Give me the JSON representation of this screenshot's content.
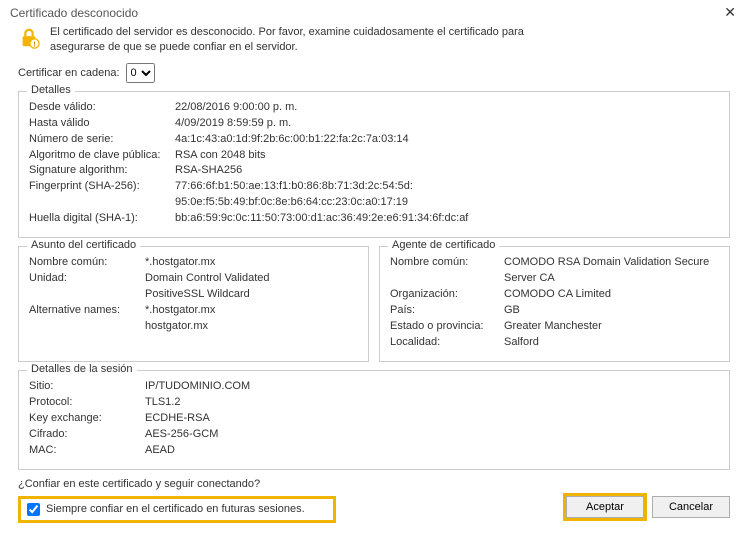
{
  "title": "Certificado desconocido",
  "warning": "El certificado del servidor es desconocido. Por favor, examine cuidadosamente el certificado para asegurarse de que se puede confiar en el servidor.",
  "chain_label": "Certificar en cadena:",
  "chain_value": "0",
  "details": {
    "title": "Detalles",
    "rows": {
      "valid_from_k": "Desde válido:",
      "valid_from_v": "22/08/2016 9:00:00 p. m.",
      "valid_to_k": "Hasta válido",
      "valid_to_v": "4/09/2019 8:59:59 p. m.",
      "serial_k": "Número de serie:",
      "serial_v": "4a:1c:43:a0:1d:9f:2b:6c:00:b1:22:fa:2c:7a:03:14",
      "pubkey_k": "Algoritmo de clave pública:",
      "pubkey_v": "RSA con 2048 bits",
      "sigalg_k": "Signature algorithm:",
      "sigalg_v": "RSA-SHA256",
      "fp256_k": "Fingerprint (SHA-256):",
      "fp256_v1": "77:66:6f:b1:50:ae:13:f1:b0:86:8b:71:3d:2c:54:5d:",
      "fp256_v2": "95:0e:f5:5b:49:bf:0c:8e:b6:64:cc:23:0c:a0:17:19",
      "fp1_k": "Huella digital (SHA-1):",
      "fp1_v": "bb:a6:59:9c:0c:11:50:73:00:d1:ac:36:49:2e:e6:91:34:6f:dc:af"
    }
  },
  "subject": {
    "title": "Asunto del certificado",
    "cn_k": "Nombre común:",
    "cn_v": "*.hostgator.mx",
    "unit_k": "Unidad:",
    "unit_v1": "Domain Control Validated",
    "unit_v2": "PositiveSSL Wildcard",
    "alt_k": "Alternative names:",
    "alt_v1": "*.hostgator.mx",
    "alt_v2": "hostgator.mx"
  },
  "issuer": {
    "title": "Agente de certificado",
    "cn_k": "Nombre común:",
    "cn_v": "COMODO RSA Domain Validation Secure Server CA",
    "org_k": "Organización:",
    "org_v": "COMODO CA Limited",
    "country_k": "País:",
    "country_v": "GB",
    "state_k": "Estado o provincia:",
    "state_v": "Greater Manchester",
    "locality_k": "Localidad:",
    "locality_v": "Salford"
  },
  "session": {
    "title": "Detalles de la sesión",
    "site_k": "Sitio:",
    "site_v": "IP/TUDOMINIO.COM",
    "proto_k": "Protocol:",
    "proto_v": "TLS1.2",
    "kex_k": "Key exchange:",
    "kex_v": "ECDHE-RSA",
    "cipher_k": "Cifrado:",
    "cipher_v": "AES-256-GCM",
    "mac_k": "MAC:",
    "mac_v": "AEAD"
  },
  "trust_question": "¿Confiar en este certificado y seguir conectando?",
  "always_trust": "Siempre confiar en el certificado en futuras sesiones.",
  "buttons": {
    "ok": "Aceptar",
    "cancel": "Cancelar"
  }
}
